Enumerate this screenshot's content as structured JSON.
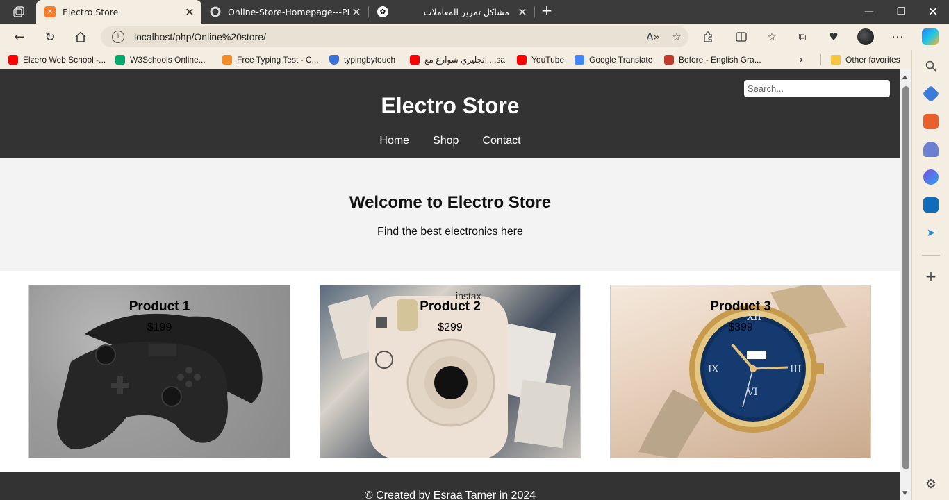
{
  "browser": {
    "tabs": [
      {
        "title": "Electro Store",
        "active": true,
        "favicon": "xampp-icon"
      },
      {
        "title": "Online-Store-Homepage---PHP-",
        "active": false,
        "favicon": "github-icon"
      },
      {
        "title": "مشاكل تمرير المعاملات",
        "active": false,
        "favicon": "chatgpt-icon"
      }
    ],
    "url": "localhost/php/Online%20store/",
    "bookmarks": [
      {
        "label": "Elzero Web School -...",
        "icon": "youtube-icon",
        "color": "#ff0000"
      },
      {
        "label": "W3Schools Online...",
        "icon": "w3schools-icon",
        "color": "#04aa6d"
      },
      {
        "label": "Free Typing Test - C...",
        "icon": "chat-icon",
        "color": "#f28c28"
      },
      {
        "label": "typingbytouch",
        "icon": "shield-icon",
        "color": "#3b6fd6"
      },
      {
        "label": "انجليزي شوارع مع ...sa",
        "icon": "youtube-icon",
        "color": "#ff0000"
      },
      {
        "label": "YouTube",
        "icon": "youtube-icon",
        "color": "#ff0000"
      },
      {
        "label": "Google Translate",
        "icon": "translate-icon",
        "color": "#4285f4"
      },
      {
        "label": "Before - English Gra...",
        "icon": "crest-icon",
        "color": "#c0392b"
      }
    ],
    "other_favorites": "Other favorites"
  },
  "site": {
    "title": "Electro Store",
    "nav": [
      "Home",
      "Shop",
      "Contact"
    ],
    "search_placeholder": "Search...",
    "hero": {
      "heading": "Welcome to Electro Store",
      "subheading": "Find the best electronics here"
    },
    "products": [
      {
        "name": "Product 1",
        "price": "$199",
        "image": "game-controllers"
      },
      {
        "name": "Product 2",
        "price": "$299",
        "image": "instax-camera"
      },
      {
        "name": "Product 3",
        "price": "$399",
        "image": "wristwatch"
      }
    ],
    "footer": "© Created by Esraa Tamer in 2024"
  }
}
